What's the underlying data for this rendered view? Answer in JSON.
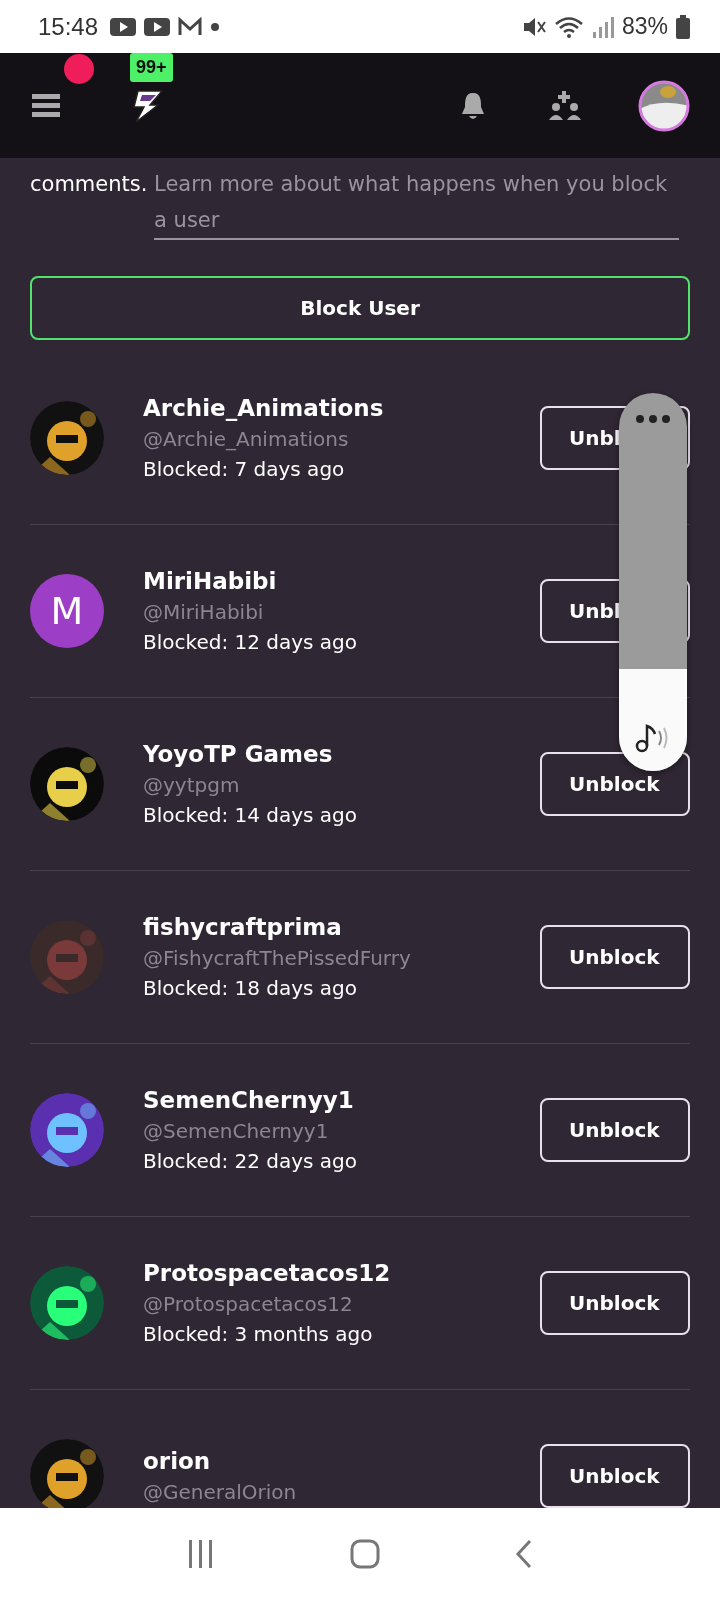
{
  "status_bar": {
    "time": "15:48",
    "battery": "83%"
  },
  "header": {
    "notification": true,
    "badge": "99+"
  },
  "intro": {
    "text": "comments.",
    "link": "Learn more about what happens when you block a user"
  },
  "block_button": {
    "label": "Block User"
  },
  "blocked_users": [
    {
      "name": "Archie_Animations",
      "handle": "@Archie_Animations",
      "blocked": "Blocked: 7 days ago",
      "button": "Unbl"
    },
    {
      "name": "MiriHabibi",
      "handle": "@MiriHabibi",
      "blocked": "Blocked: 12 days ago",
      "avatar": {
        "kind": "letter",
        "letter": "M"
      },
      "button": "Unbl"
    },
    {
      "name": "YoyoTP Games",
      "handle": "@yytpgm",
      "blocked": "Blocked: 14 days ago",
      "button": "Unblock"
    },
    {
      "name": "fishycraftprima",
      "handle": "@FishycraftThePissedFurry",
      "blocked": "Blocked: 18 days ago",
      "button": "Unblock"
    },
    {
      "name": "SemenChernyy1",
      "handle": "@SemenChernyy1",
      "blocked": "Blocked: 22 days ago",
      "button": "Unblock"
    },
    {
      "name": "Protospacetacos12",
      "handle": "@Protospacetacos12",
      "blocked": "Blocked: 3 months ago",
      "button": "Unblock"
    },
    {
      "name": "orion",
      "handle": "@GeneralOrion",
      "button": "Unblock"
    }
  ],
  "volume_panel": {
    "level": 0.27
  }
}
